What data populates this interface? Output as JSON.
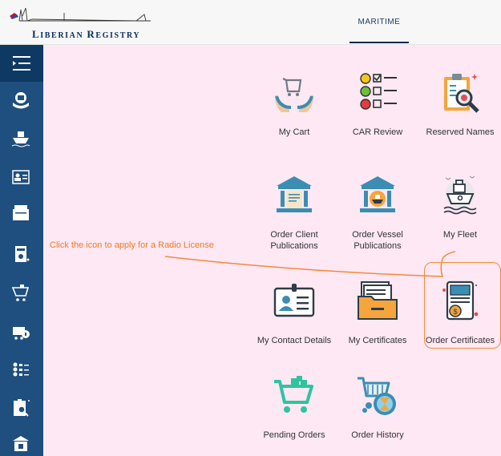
{
  "header": {
    "logo_text": "Liberian Registry",
    "logo_first": "L",
    "logo_rest": "IBERIAN",
    "logo_first2": "R",
    "logo_rest2": "EGISTRY",
    "tab_label": "MARITIME"
  },
  "sidebar": {
    "menu_icon": "menu-icon",
    "items": [
      {
        "icon": "hands-shield-icon"
      },
      {
        "icon": "ship-icon"
      },
      {
        "icon": "contact-card-icon"
      },
      {
        "icon": "certificates-folder-icon"
      },
      {
        "icon": "certificate-order-icon"
      },
      {
        "icon": "cart-icon"
      },
      {
        "icon": "order-history-icon"
      },
      {
        "icon": "car-review-icon"
      },
      {
        "icon": "reserved-names-icon"
      },
      {
        "icon": "publications-icon"
      }
    ]
  },
  "tiles": [
    {
      "label": "My Cart",
      "icon": "cart-hands-icon"
    },
    {
      "label": "CAR Review",
      "icon": "checklist-icon"
    },
    {
      "label": "Reserved Names",
      "icon": "clipboard-search-icon"
    },
    {
      "label": "Order Client Publications",
      "icon": "building-document-icon"
    },
    {
      "label": "Order Vessel Publications",
      "icon": "building-ship-icon"
    },
    {
      "label": "My Fleet",
      "icon": "ship-icon"
    },
    {
      "label": "My Contact Details",
      "icon": "id-card-icon"
    },
    {
      "label": "My Certificates",
      "icon": "folder-icon"
    },
    {
      "label": "Order Certificates",
      "icon": "certificate-coin-icon"
    },
    {
      "label": "Pending Orders",
      "icon": "shopping-cart-icon"
    },
    {
      "label": "Order History",
      "icon": "cart-hourglass-icon"
    }
  ],
  "tile_labels_split": {
    "ocp1": "Order Client",
    "ocp2": "Publications",
    "ovp1": "Order Vessel",
    "ovp2": "Publications"
  },
  "annotation": {
    "text": "Click the icon to apply for a Radio License"
  },
  "colors": {
    "sidebar": "#1e4f7e",
    "sidebar_top": "#0e3963",
    "main_bg": "#fde8f3",
    "accent_orange": "#f4893b",
    "icon_teal": "#3b8db3"
  }
}
